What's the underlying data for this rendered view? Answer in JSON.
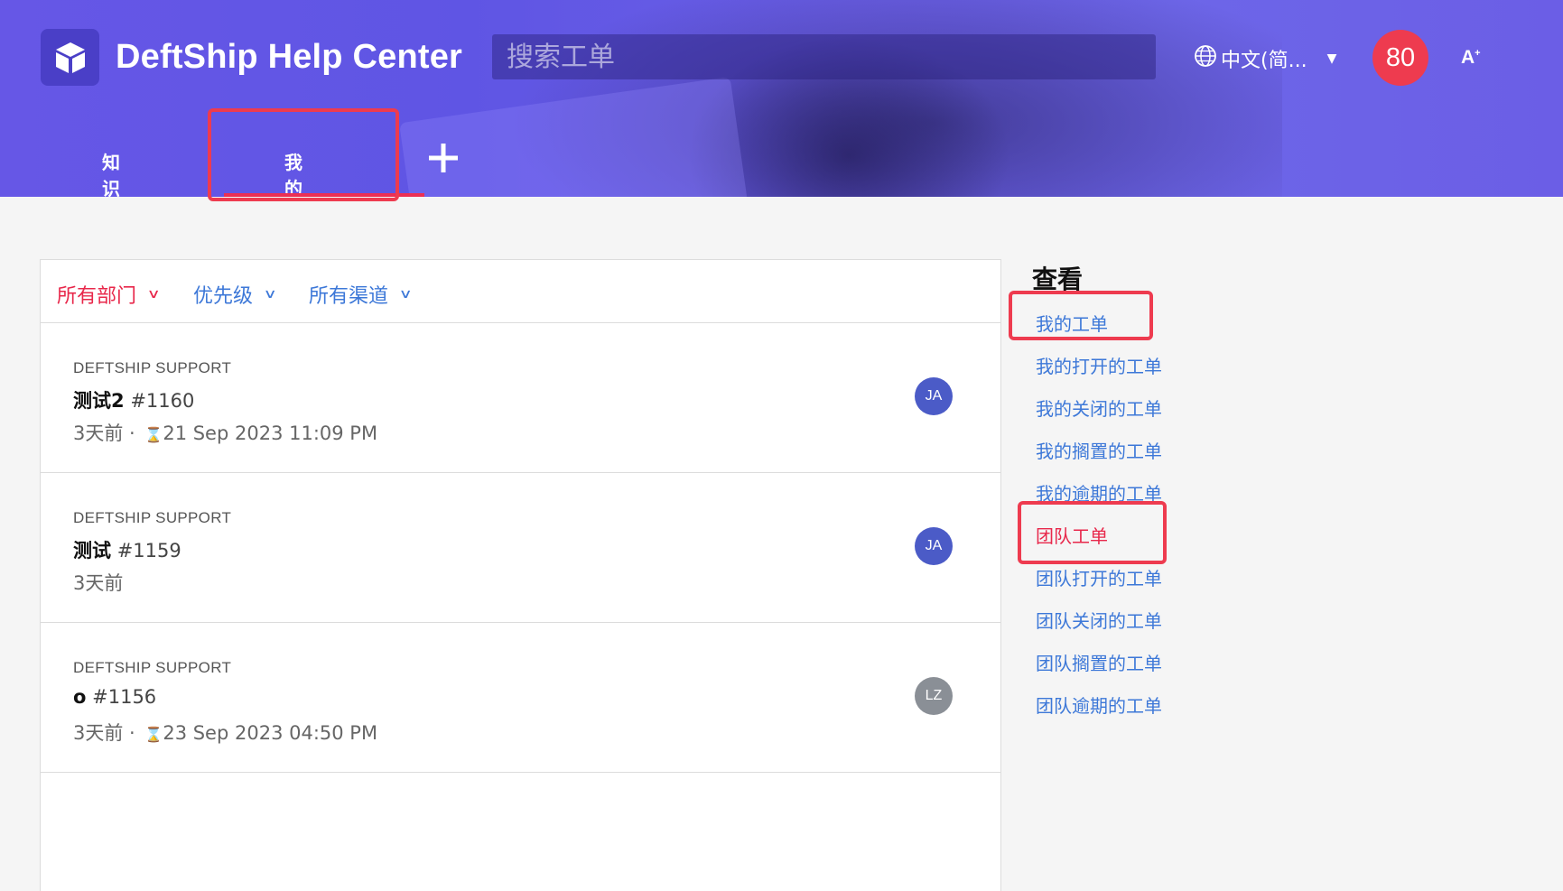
{
  "colors": {
    "header_bg": "#6657e6",
    "accent_red": "#e8284b",
    "link_blue": "#3d78d8",
    "badge_red": "#ee3b4f",
    "avatar_ja": "#4b5bc7",
    "avatar_lz": "#8a8f96"
  },
  "header": {
    "brand": "DeftShip Help Center",
    "logo_icon": "cube-icon",
    "search": {
      "placeholder": "搜索工单",
      "icon": "search-icon"
    },
    "language": {
      "label": "中文(简...",
      "icon": "globe-icon",
      "caret_icon": "caret-down-icon"
    },
    "notification_count": "80",
    "font_size_label": "A",
    "font_size_sup": "+"
  },
  "tabs": {
    "knowledge_base": "知识库",
    "my_area": "我的区域",
    "add_icon": "plus-icon"
  },
  "filters": {
    "department": "所有部门",
    "priority": "优先级",
    "channel": "所有渠道",
    "chevron_icon": "chevron-down-icon"
  },
  "tickets": [
    {
      "department": "DEFTSHIP SUPPORT",
      "title": "测试2",
      "number": "#1160",
      "age": "3天前",
      "separator": " · ",
      "due": "21 Sep 2023 11:09 PM",
      "avatar": "JA"
    },
    {
      "department": "DEFTSHIP SUPPORT",
      "title": "测试",
      "number": "#1159",
      "age": "3天前",
      "avatar": "JA"
    },
    {
      "department": "DEFTSHIP SUPPORT",
      "title": "o",
      "number": "#1156",
      "age": "3天前",
      "separator": " · ",
      "due": "23 Sep 2023 04:50 PM",
      "avatar": "LZ"
    }
  ],
  "sidebar": {
    "title": "查看",
    "links": [
      "我的工单",
      "我的打开的工单",
      "我的关闭的工单",
      "我的搁置的工单",
      "我的逾期的工单",
      "团队工单",
      "团队打开的工单",
      "团队关闭的工单",
      "团队搁置的工单",
      "团队逾期的工单"
    ]
  }
}
